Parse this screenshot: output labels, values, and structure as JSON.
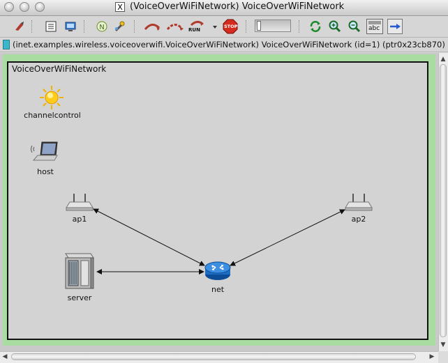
{
  "window": {
    "title": "(VoiceOverWiFiNetwork) VoiceOverWiFiNetwork",
    "title_x_glyph": "X"
  },
  "toolbar": {
    "buttons": [
      {
        "name": "step-icon"
      },
      {
        "name": "object-tree-icon"
      },
      {
        "name": "module-output-icon"
      },
      {
        "name": "new-network-icon"
      },
      {
        "name": "configure-icon"
      },
      {
        "name": "run-icon"
      },
      {
        "name": "fast-run-icon"
      },
      {
        "name": "express-run-icon"
      },
      {
        "name": "stop-icon"
      },
      {
        "name": "refresh-icon"
      },
      {
        "name": "zoom-in-icon"
      },
      {
        "name": "zoom-out-icon"
      },
      {
        "name": "labels-icon"
      },
      {
        "name": "arrow-right-icon"
      }
    ],
    "run_label": "RUN",
    "stop_label": "STOP",
    "labels_button_text": "abc"
  },
  "infobar": {
    "text": "(inet.examples.wireless.voiceoverwifi.VoiceOverWiFiNetwork) VoiceOverWiFiNetwork  (id=1)  (ptr0x23cb870)",
    "swatch_color": "#3ab8c9"
  },
  "network": {
    "name": "VoiceOverWiFiNetwork",
    "nodes": [
      {
        "id": "channelcontrol",
        "label": "channelcontrol",
        "icon": "sun-icon"
      },
      {
        "id": "host",
        "label": "host",
        "icon": "laptop-icon"
      },
      {
        "id": "ap1",
        "label": "ap1",
        "icon": "access-point-icon"
      },
      {
        "id": "ap2",
        "label": "ap2",
        "icon": "access-point-icon"
      },
      {
        "id": "server",
        "label": "server",
        "icon": "server-icon"
      },
      {
        "id": "net",
        "label": "net",
        "icon": "router-icon"
      }
    ],
    "links": [
      {
        "from": "ap1",
        "to": "net"
      },
      {
        "from": "ap2",
        "to": "net"
      },
      {
        "from": "server",
        "to": "net"
      }
    ]
  },
  "colors": {
    "frame_green": "#a8dca0",
    "canvas_gray": "#d3d3d3",
    "router_blue": "#1e6fc4"
  }
}
